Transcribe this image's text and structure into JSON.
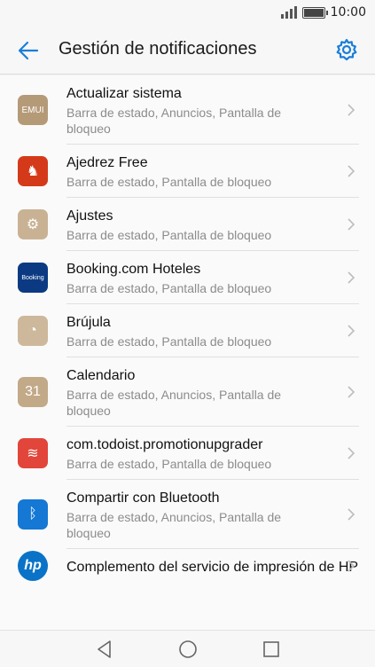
{
  "status": {
    "time": "10:00"
  },
  "header": {
    "title": "Gestión de notificaciones"
  },
  "apps": [
    {
      "name": "Actualizar sistema",
      "sub": "Barra de estado, Anuncios, Pantalla de bloqueo",
      "icon": "emui-icon",
      "icon_text": "EMUI",
      "bg": "#b59a78"
    },
    {
      "name": "Ajedrez Free",
      "sub": "Barra de estado, Pantalla de bloqueo",
      "icon": "chess-knight-icon",
      "icon_text": "♞",
      "bg": "#d43a1a"
    },
    {
      "name": "Ajustes",
      "sub": "Barra de estado, Pantalla de bloqueo",
      "icon": "settings-app-icon",
      "icon_text": "⚙",
      "bg": "#c9b294"
    },
    {
      "name": "Booking.com Hoteles",
      "sub": "Barra de estado, Pantalla de bloqueo",
      "icon": "booking-icon",
      "icon_text": "Booking",
      "bg": "#0b3a82"
    },
    {
      "name": "Brújula",
      "sub": "Barra de estado, Pantalla de bloqueo",
      "icon": "compass-icon",
      "icon_text": "◔",
      "bg": "#cdb89b"
    },
    {
      "name": "Calendario",
      "sub": "Barra de estado, Anuncios, Pantalla de bloqueo",
      "icon": "calendar-icon",
      "icon_text": "31",
      "bg": "#c2a988"
    },
    {
      "name": "com.todoist.promotionupgrader",
      "sub": "Barra de estado, Pantalla de bloqueo",
      "icon": "todoist-icon",
      "icon_text": "≋",
      "bg": "#e2453a"
    },
    {
      "name": "Compartir con Bluetooth",
      "sub": "Barra de estado, Anuncios, Pantalla de bloqueo",
      "icon": "bluetooth-icon",
      "icon_text": "ᛒ",
      "bg": "#1478d4"
    },
    {
      "name": "Complemento del servicio de impresión de HP",
      "sub": "",
      "icon": "hp-icon",
      "icon_text": "hp",
      "bg": "#0a73c7"
    }
  ],
  "colors": {
    "accent": "#1a7fd8"
  }
}
